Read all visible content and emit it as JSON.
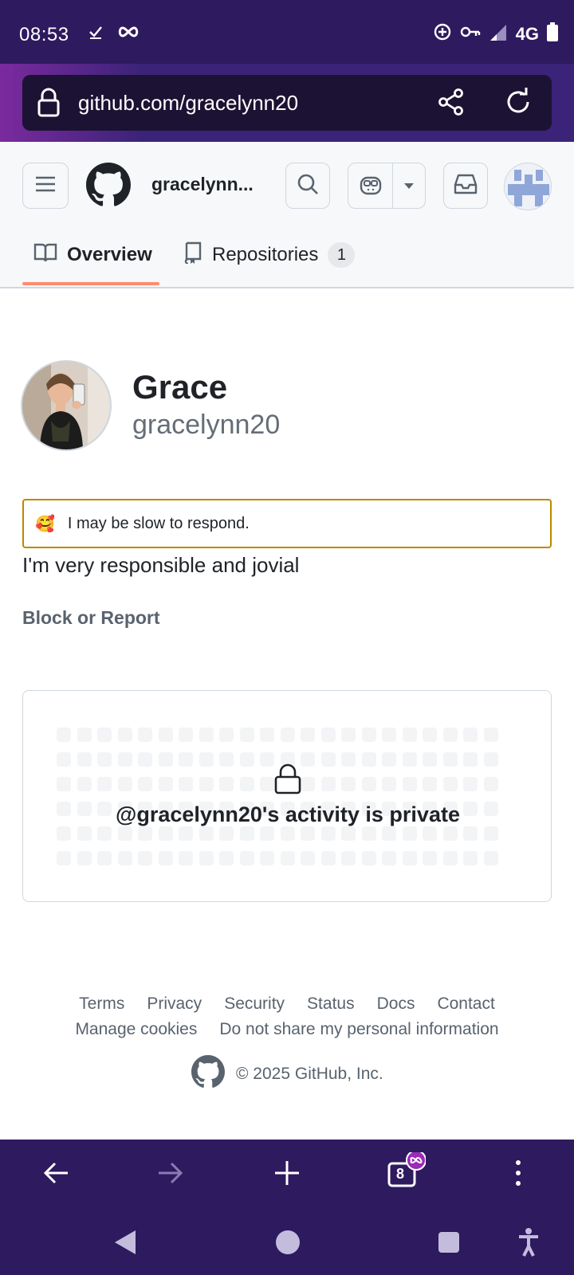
{
  "status_bar": {
    "time": "08:53",
    "network": "4G"
  },
  "browser": {
    "url": "github.com/gracelynn20",
    "tab_count": "8"
  },
  "header": {
    "username": "gracelynn..."
  },
  "tabs": [
    {
      "label": "Overview"
    },
    {
      "label": "Repositories",
      "count": "1"
    }
  ],
  "profile": {
    "name": "Grace",
    "login": "gracelynn20",
    "status_emoji": "🥰",
    "status_text": "I may be slow to respond.",
    "bio": "I'm very responsible and jovial",
    "block_report": "Block or Report"
  },
  "activity": {
    "message": "@gracelynn20's activity is private"
  },
  "footer": {
    "links_row1": [
      "Terms",
      "Privacy",
      "Security",
      "Status",
      "Docs",
      "Contact"
    ],
    "links_row2": [
      "Manage cookies",
      "Do not share my personal information"
    ],
    "copyright": "© 2025 GitHub, Inc."
  },
  "colors": {
    "system_bar": "#2e1a5e",
    "tab_underline": "#fd8c73",
    "status_border": "#bf8700"
  }
}
